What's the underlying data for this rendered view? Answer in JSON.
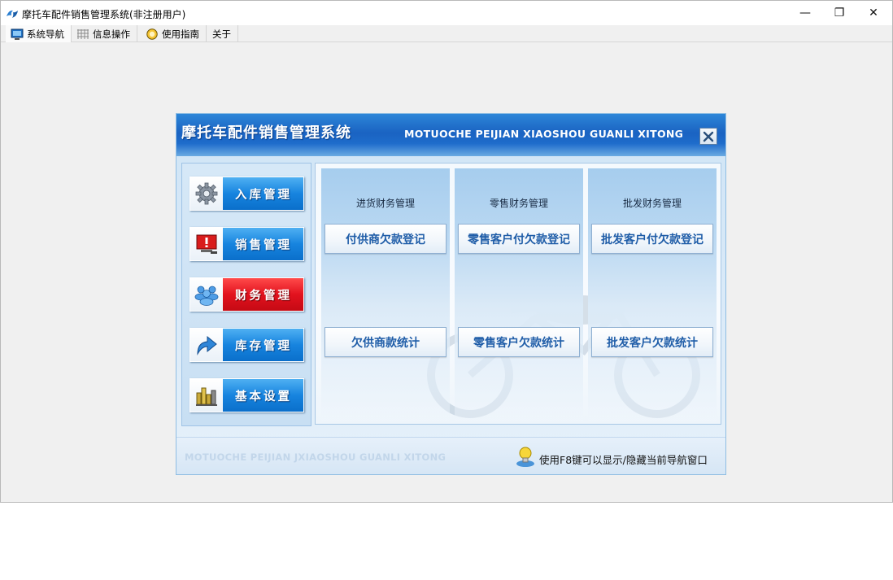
{
  "window": {
    "title": "摩托车配件销售管理系统(非注册用户)",
    "controls": {
      "minimize": "—",
      "restore": "❐",
      "close": "✕"
    }
  },
  "menu": [
    {
      "label": "系统导航",
      "icon": "monitor-icon",
      "active": true
    },
    {
      "label": "信息操作",
      "icon": "grid-icon",
      "active": false
    },
    {
      "label": "使用指南",
      "icon": "help-icon",
      "active": false
    },
    {
      "label": "关于",
      "icon": "",
      "active": false
    }
  ],
  "panel": {
    "title": "摩托车配件销售管理系统",
    "title_en": "MOTUOCHE PEIJIAN XIAOSHOU GUANLI XITONG",
    "nav": [
      {
        "label": "入库管理",
        "icon": "gear-icon",
        "selected": false
      },
      {
        "label": "销售管理",
        "icon": "alert-monitor-icon",
        "selected": false
      },
      {
        "label": "财务管理",
        "icon": "users-icon",
        "selected": true
      },
      {
        "label": "库存管理",
        "icon": "arrow-icon",
        "selected": false
      },
      {
        "label": "基本设置",
        "icon": "chart-icon",
        "selected": false
      }
    ],
    "columns": [
      {
        "title": "进货财务管理",
        "top_button": "付供商欠款登记",
        "bottom_button": "欠供商款统计"
      },
      {
        "title": "零售财务管理",
        "top_button": "零售客户付欠款登记",
        "bottom_button": "零售客户欠款统计"
      },
      {
        "title": "批发财务管理",
        "top_button": "批发客户付欠款登记",
        "bottom_button": "批发客户欠款统计"
      }
    ],
    "footer_en": "MOTUOCHE PEIJIAN JXIAOSHOU GUANLI XITONG",
    "footer_tip": "使用F8键可以显示/隐藏当前导航窗口"
  },
  "colors": {
    "nav_blue": "#1784df",
    "nav_selected_red": "#e2121e",
    "header_blue": "#1a63c2",
    "action_text": "#1f5da8"
  }
}
